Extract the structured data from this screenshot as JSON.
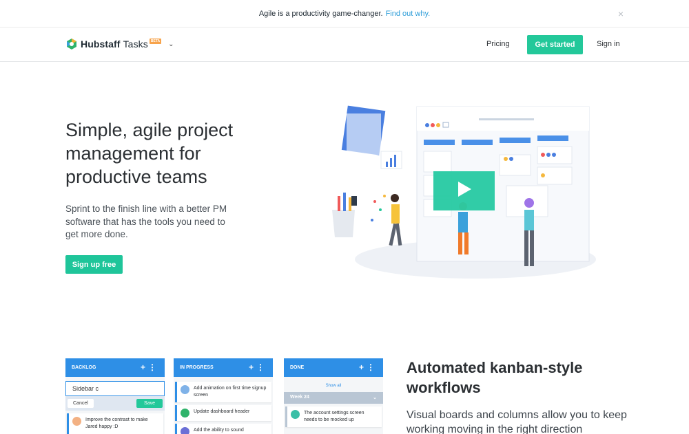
{
  "announcement": {
    "text": "Agile is a productivity game-changer.",
    "link": "Find out why.",
    "close": "×"
  },
  "nav": {
    "brand": "Hubstaff",
    "product": "Tasks",
    "beta": "BETA",
    "pricing": "Pricing",
    "get_started": "Get started",
    "sign_in": "Sign in"
  },
  "hero": {
    "title": "Simple, agile project management for productive teams",
    "subtitle": "Sprint to the finish line with a better PM software that has the tools you need to get more done.",
    "cta": "Sign up free"
  },
  "kanban": {
    "columns": [
      {
        "title": "BACKLOG"
      },
      {
        "title": "IN PROGRESS"
      },
      {
        "title": "DONE"
      }
    ],
    "backlog_input": "Sidebar c",
    "cancel": "Cancel",
    "save": "Save",
    "backlog_card": "Improve the contrast to make Jared happy :D",
    "inprogress_cards": [
      "Add animation on first time signup screen",
      "Update dashboard header",
      "Add the ability to sound"
    ],
    "show_all": "Show all",
    "week": "Week 24",
    "done_card": "The account settings screen needs to be mocked up"
  },
  "feature": {
    "title": "Automated kanban-style workflows",
    "subtitle": "Visual boards and columns allow you to keep working moving in the right direction"
  },
  "colors": {
    "accent": "#23c89a",
    "link": "#2a9cd8",
    "column_header": "#2e8fe6"
  }
}
